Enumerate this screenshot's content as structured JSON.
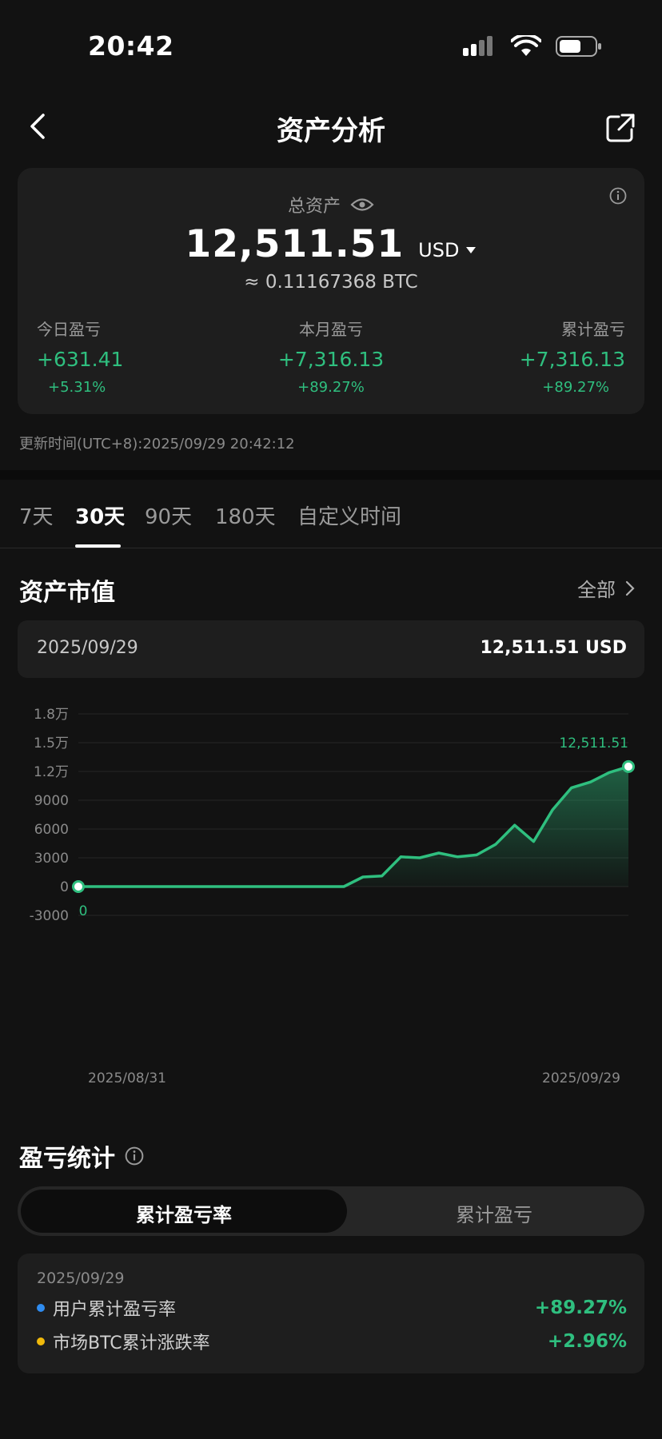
{
  "status_bar": {
    "time": "20:42"
  },
  "nav": {
    "title": "资产分析"
  },
  "summary": {
    "total_label": "总资产",
    "total_value": "12,511.51",
    "currency": "USD",
    "btc_equiv": "≈ 0.11167368 BTC",
    "today": {
      "label": "今日盈亏",
      "value": "+631.41",
      "pct": "+5.31%"
    },
    "month": {
      "label": "本月盈亏",
      "value": "+7,316.13",
      "pct": "+89.27%"
    },
    "cumulative": {
      "label": "累计盈亏",
      "value": "+7,316.13",
      "pct": "+89.27%"
    },
    "update_time": "更新时间(UTC+8):2025/09/29 20:42:12"
  },
  "tabs": [
    {
      "label": "7天",
      "active": false
    },
    {
      "label": "30天",
      "active": true
    },
    {
      "label": "90天",
      "active": false
    },
    {
      "label": "180天",
      "active": false
    },
    {
      "label": "自定义时间",
      "active": false
    }
  ],
  "asset_section": {
    "title": "资产市值",
    "more_label": "全部",
    "selected_date": "2025/09/29",
    "selected_value": "12,511.51 USD"
  },
  "colors": {
    "accent_green": "#2fbf7f",
    "blue_dot": "#2f8cf0",
    "yellow_dot": "#f0b90b"
  },
  "chart_data": {
    "type": "area",
    "y_tick_labels": [
      "1.8万",
      "1.5万",
      "1.2万",
      "9000",
      "6000",
      "3000",
      "0",
      "-3000"
    ],
    "y_ticks": [
      18000,
      15000,
      12000,
      9000,
      6000,
      3000,
      0,
      -3000
    ],
    "ylim": [
      -3000,
      18000
    ],
    "x_start_label": "2025/08/31",
    "x_end_label": "2025/09/29",
    "start_label": "0",
    "end_label": "12,511.51",
    "values": [
      0,
      0,
      0,
      0,
      0,
      0,
      0,
      0,
      0,
      0,
      0,
      0,
      0,
      0,
      0,
      1000,
      1100,
      3100,
      3000,
      3500,
      3100,
      3300,
      4400,
      6400,
      4700,
      8000,
      10300,
      10900,
      11900,
      12511.51
    ],
    "grid": true
  },
  "pnl_stats": {
    "title": "盈亏统计",
    "toggle_active": "累计盈亏率",
    "toggle_inactive": "累计盈亏",
    "date": "2025/09/29",
    "rows": [
      {
        "label": "用户累计盈亏率",
        "value": "+89.27%"
      },
      {
        "label": "市场BTC累计涨跌率",
        "value": "+2.96%"
      }
    ]
  }
}
